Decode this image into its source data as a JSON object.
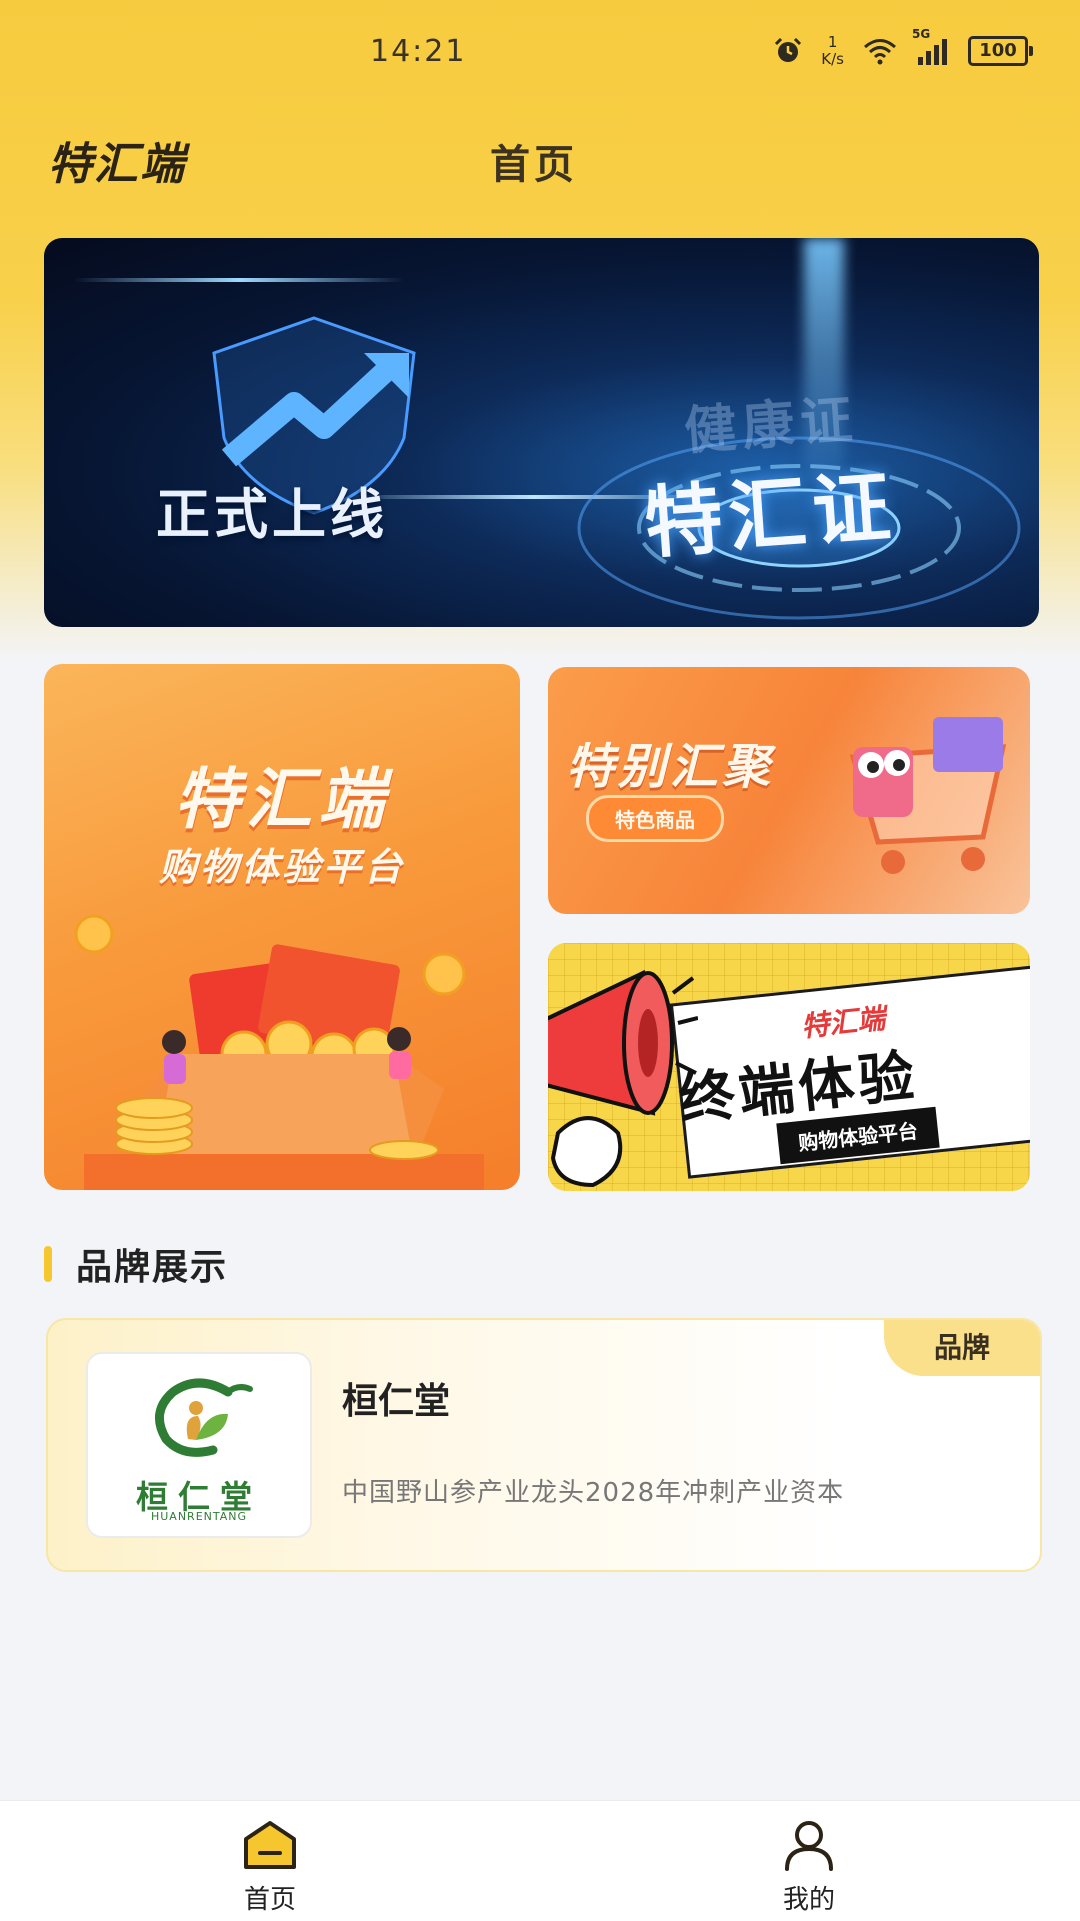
{
  "status_bar": {
    "time": "14:21",
    "net_speed_value": "1",
    "net_speed_unit": "K/s",
    "network": "5G",
    "battery": "100"
  },
  "header": {
    "app_logo": "特汇端",
    "page_title": "首页"
  },
  "banner": {
    "left_text": "正式上线",
    "faded_text": "健康证",
    "main_text": "特汇证"
  },
  "promo_big": {
    "title": "特汇端",
    "subtitle": "购物体验平台"
  },
  "promo_small_1": {
    "title": "特别汇聚",
    "badge": "特色商品"
  },
  "promo_small_2": {
    "brand": "特汇端",
    "title": "终端体验",
    "tag": "购物体验平台"
  },
  "brand_section": {
    "title": "品牌展示",
    "card": {
      "tag": "品牌",
      "logo_name": "桓仁堂",
      "logo_sub": "HUANRENTANG",
      "name": "桓仁堂",
      "description": "中国野山参产业龙头2028年冲刺产业资本"
    }
  },
  "tab_bar": {
    "items": [
      {
        "label": "首页",
        "icon": "home-icon",
        "active": true
      },
      {
        "label": "我的",
        "icon": "user-icon",
        "active": false
      }
    ]
  },
  "colors": {
    "accent": "#f7cb3e",
    "tab_active": "#f5c62e"
  }
}
